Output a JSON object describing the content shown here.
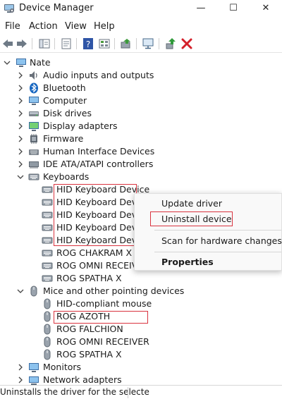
{
  "window": {
    "title": "Device Manager",
    "min_glyph": "—",
    "max_glyph": "☐",
    "close_glyph": "✕"
  },
  "menubar": {
    "items": [
      "File",
      "Action",
      "View",
      "Help"
    ]
  },
  "toolbar": {
    "icons": [
      "back-arrow-icon",
      "forward-arrow-icon",
      "show-hide-console-tree-icon",
      "properties-icon",
      "help-icon",
      "view-icon",
      "update-driver-icon",
      "scan-hardware-icon",
      "enable-device-icon",
      "uninstall-device-icon"
    ]
  },
  "tree": {
    "root": "Nate",
    "categories": [
      {
        "label": "Audio inputs and outputs",
        "icon": "speaker-icon"
      },
      {
        "label": "Bluetooth",
        "icon": "bluetooth-icon"
      },
      {
        "label": "Computer",
        "icon": "computer-icon"
      },
      {
        "label": "Disk drives",
        "icon": "disk-drive-icon"
      },
      {
        "label": "Display adapters",
        "icon": "display-adapter-icon"
      },
      {
        "label": "Firmware",
        "icon": "firmware-icon"
      },
      {
        "label": "Human Interface Devices",
        "icon": "hid-icon"
      },
      {
        "label": "IDE ATA/ATAPI controllers",
        "icon": "ide-controller-icon"
      }
    ],
    "keyboards": {
      "label": "Keyboards",
      "devices": [
        "HID Keyboard Device",
        "HID Keyboard Device",
        "HID Keyboard Device",
        "HID Keyboard Device",
        "HID Keyboard Device",
        "ROG CHAKRAM X",
        "ROG OMNI RECEIVER",
        "ROG SPATHA X"
      ]
    },
    "mice": {
      "label": "Mice and other pointing devices",
      "devices": [
        "HID-compliant mouse",
        "ROG AZOTH",
        "ROG FALCHION",
        "ROG OMNI RECEIVER",
        "ROG SPATHA X"
      ]
    },
    "after": [
      {
        "label": "Monitors",
        "icon": "monitor-icon"
      },
      {
        "label": "Network adapters",
        "icon": "network-adapter-icon"
      }
    ]
  },
  "context_menu": {
    "items": [
      "Update driver",
      "Uninstall device",
      "Scan for hardware changes",
      "Properties"
    ]
  },
  "status": {
    "text": "Uninstalls the driver for the selecte"
  },
  "colors": {
    "highlight_border": "#d9333f",
    "uninstall_red": "#d4202a",
    "bluetooth_blue": "#1565c0"
  }
}
